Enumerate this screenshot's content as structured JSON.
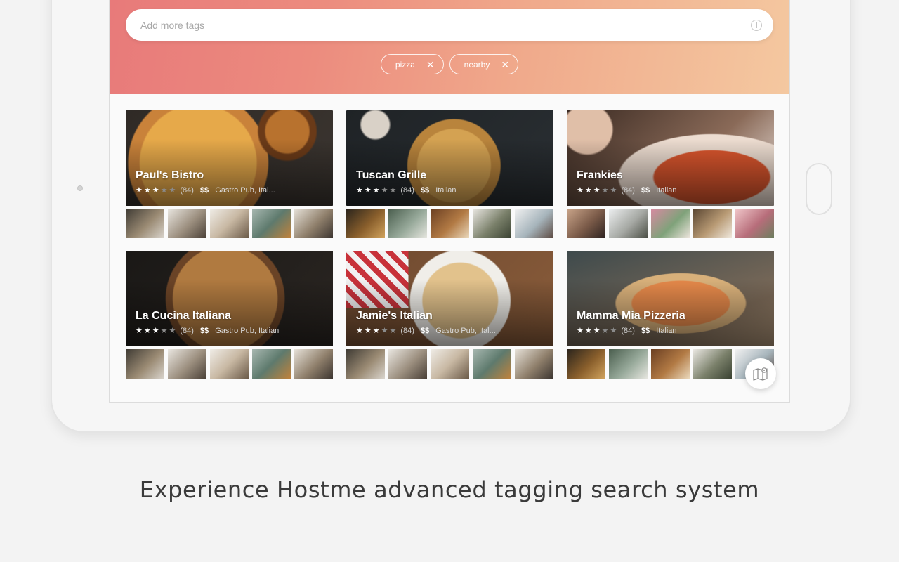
{
  "search": {
    "placeholder": "Add more tags"
  },
  "tags": [
    {
      "label": "pizza"
    },
    {
      "label": "nearby"
    }
  ],
  "restaurants": [
    {
      "name": "Paul's Bistro",
      "rating": 3,
      "reviews": "(84)",
      "price": "$$",
      "cuisine": "Gastro Pub, Ital..."
    },
    {
      "name": "Tuscan Grille",
      "rating": 3,
      "reviews": "(84)",
      "price": "$$",
      "cuisine": "Italian"
    },
    {
      "name": "Frankies",
      "rating": 3,
      "reviews": "(84)",
      "price": "$$",
      "cuisine": "Italian"
    },
    {
      "name": "La Cucina Italiana",
      "rating": 3,
      "reviews": "(84)",
      "price": "$$",
      "cuisine": "Gastro Pub, Italian"
    },
    {
      "name": "Jamie's Italian",
      "rating": 3,
      "reviews": "(84)",
      "price": "$$",
      "cuisine": "Gastro Pub, Ital..."
    },
    {
      "name": "Mamma Mia Pizzeria",
      "rating": 3,
      "reviews": "(84)",
      "price": "$$",
      "cuisine": "Italian"
    }
  ],
  "map_button": {
    "icon": "map-icon"
  },
  "tagline": "Experience Hostme advanced tagging search system",
  "colors": {
    "header_gradient_start": "#e87a7a",
    "header_gradient_end": "#f4c8a0",
    "background": "#f3f3f3"
  }
}
